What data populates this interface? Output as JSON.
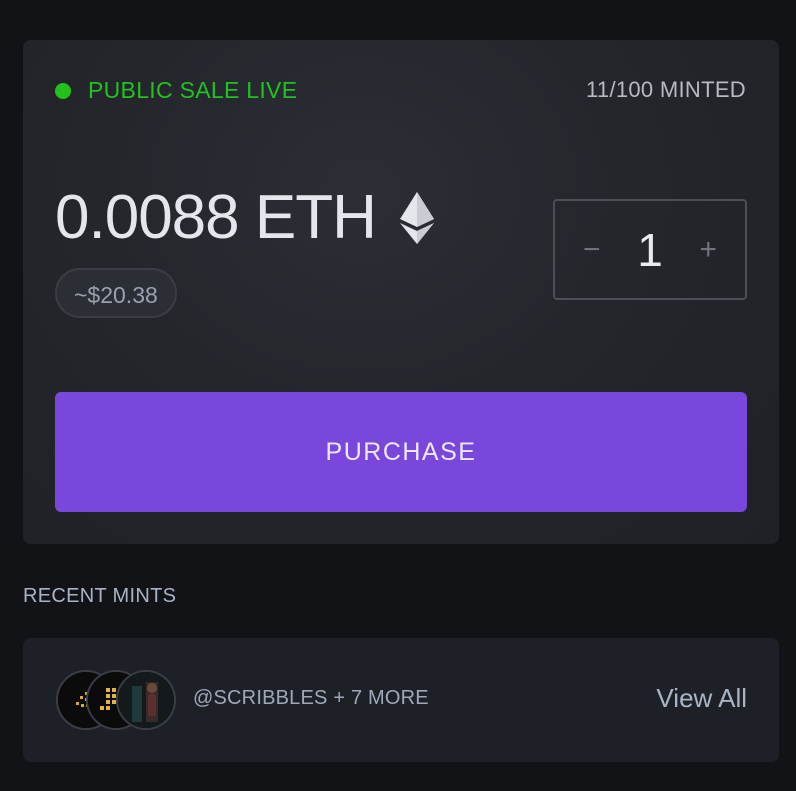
{
  "sale": {
    "status": "PUBLIC SALE LIVE",
    "minted": "11/100 MINTED",
    "price": "0.0088 ETH",
    "usd": "~$20.38",
    "currency_icon": "ethereum-icon",
    "status_color": "#22c21e"
  },
  "stepper": {
    "minus": "−",
    "quantity": "1",
    "plus": "+"
  },
  "purchase": {
    "label": "PURCHASE",
    "color": "#7a47dd"
  },
  "recent": {
    "title": "RECENT MINTS",
    "summary": "@SCRIBBLES + 7 MORE",
    "view_all": "View All"
  }
}
